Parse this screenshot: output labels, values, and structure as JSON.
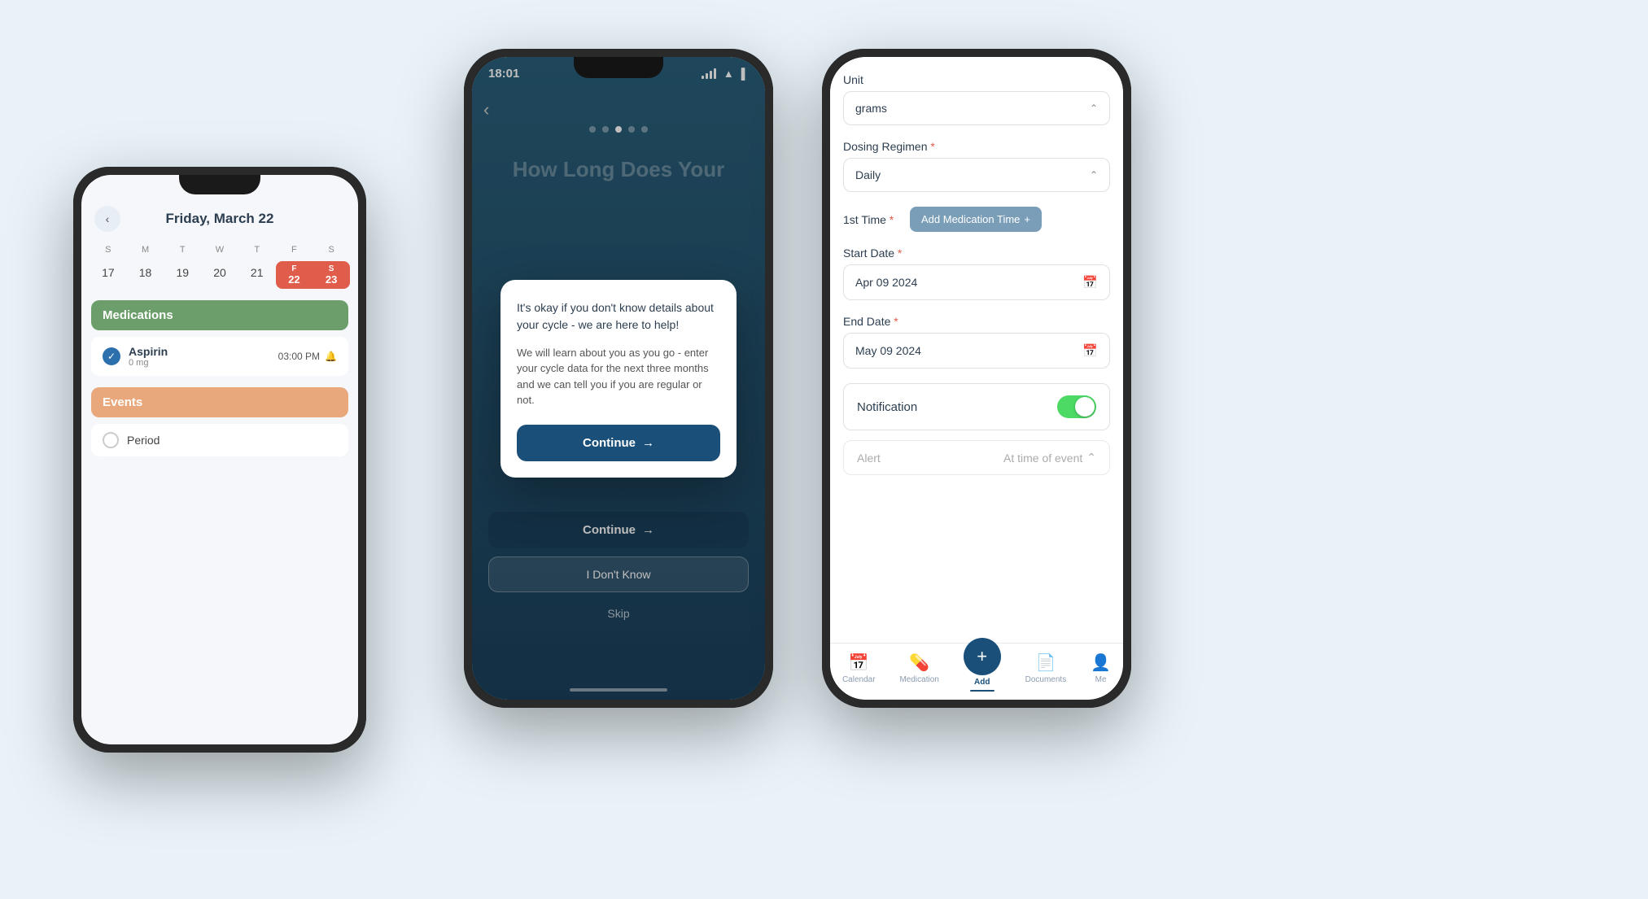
{
  "background": "#e8f2f8",
  "phone_left": {
    "header": {
      "back_icon": "‹",
      "title": "Friday, March 22"
    },
    "week": {
      "days_of_week": [
        "S",
        "M",
        "T",
        "W",
        "T",
        "F",
        "S"
      ],
      "dates": [
        "17",
        "18",
        "19",
        "20",
        "21",
        "22",
        "23"
      ]
    },
    "medications_label": "Medications",
    "medications": [
      {
        "name": "Aspirin",
        "dose": "0 mg",
        "time": "03:00 PM",
        "checked": true
      }
    ],
    "events_label": "Events",
    "events": [
      {
        "name": "Period"
      }
    ]
  },
  "phone_center": {
    "status_bar": {
      "time": "18:01",
      "icons": "signal wifi battery"
    },
    "heading": "How Long Does Your",
    "modal": {
      "text_primary": "It's okay if you don't know details about your cycle - we are here to help!",
      "text_secondary": "We will learn about you as you go - enter your cycle data for the next three months and we can tell you if you are regular or not.",
      "continue_btn": "Continue",
      "continue_arrow": "→"
    },
    "bottom_btns": {
      "continue": "Continue",
      "continue_arrow": "→",
      "dont_know": "I Don't Know",
      "skip": "Skip"
    },
    "dots": [
      0,
      1,
      2,
      3,
      4
    ],
    "active_dot": 2
  },
  "phone_right": {
    "form": {
      "unit_label": "Unit",
      "unit_value": "grams",
      "dosing_label": "Dosing Regimen",
      "dosing_required": true,
      "dosing_value": "Daily",
      "first_time_label": "1st Time",
      "first_time_required": true,
      "add_time_btn": "Add Medication Time",
      "add_time_icon": "+",
      "start_date_label": "Start Date",
      "start_date_required": true,
      "start_date_value": "Apr 09 2024",
      "end_date_label": "End Date",
      "end_date_required": true,
      "end_date_value": "May 09 2024",
      "notification_label": "Notification",
      "notification_on": true,
      "alert_label": "Alert",
      "alert_value": "At time of event",
      "alert_arrow": "⌃"
    },
    "bottom_nav": {
      "items": [
        {
          "icon": "📅",
          "label": "Calendar",
          "active": false
        },
        {
          "icon": "💊",
          "label": "Medication",
          "active": false
        },
        {
          "icon": "+",
          "label": "Add",
          "active": true
        },
        {
          "icon": "📄",
          "label": "Documents",
          "active": false
        },
        {
          "icon": "👤",
          "label": "Me",
          "active": false
        }
      ]
    }
  }
}
